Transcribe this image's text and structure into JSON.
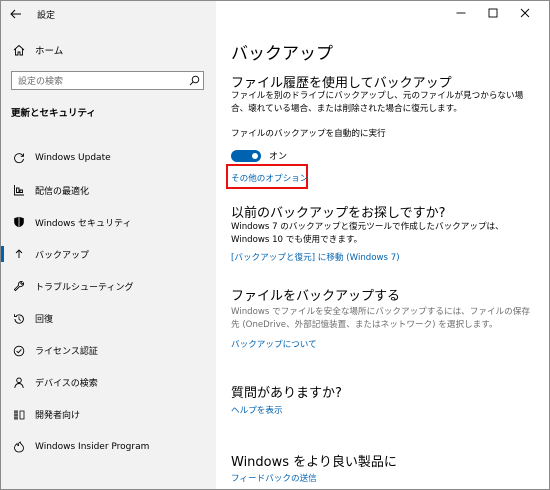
{
  "window": {
    "title": "設定",
    "controls": [
      "minimize",
      "maximize",
      "close"
    ]
  },
  "sidebar": {
    "home_label": "ホーム",
    "search_placeholder": "設定の検索",
    "section_title": "更新とセキュリティ",
    "items": [
      {
        "label": "Windows Update",
        "icon": "refresh-icon"
      },
      {
        "label": "配信の最適化",
        "icon": "delivery-optimization-icon"
      },
      {
        "label": "Windows セキュリティ",
        "icon": "shield-icon"
      },
      {
        "label": "バックアップ",
        "icon": "backup-icon",
        "active": true
      },
      {
        "label": "トラブルシューティング",
        "icon": "wrench-icon"
      },
      {
        "label": "回復",
        "icon": "recovery-icon"
      },
      {
        "label": "ライセンス認証",
        "icon": "checkmark-circle-icon"
      },
      {
        "label": "デバイスの検索",
        "icon": "person-pin-icon"
      },
      {
        "label": "開発者向け",
        "icon": "developer-icon"
      },
      {
        "label": "Windows Insider Program",
        "icon": "insider-icon"
      }
    ]
  },
  "main": {
    "page_title": "バックアップ",
    "file_history": {
      "heading": "ファイル履歴を使用してバックアップ",
      "description": "ファイルを別のドライブにバックアップし、元のファイルが見つからない場合、壊れている場合、または削除された場合に復元します。",
      "auto_backup_label": "ファイルのバックアップを自動的に実行",
      "toggle_state": "オン",
      "toggle_on": true,
      "more_options_link": "その他のオプション"
    },
    "older_backup": {
      "heading": "以前のバックアップをお探しですか?",
      "description": "Windows 7 のバックアップと復元ツールで作成したバックアップは、Windows 10 でも使用できます。",
      "link": "[バックアップと復元] に移動 (Windows 7)"
    },
    "backup_files": {
      "heading": "ファイルをバックアップする",
      "description": "Windows でファイルを安全な場所にバックアップするには、ファイルの保存先 (OneDrive、外部記憶装置、またはネットワーク) を選択します。",
      "link": "バックアップについて"
    },
    "questions": {
      "heading": "質問がありますか?",
      "link": "ヘルプを表示"
    },
    "improve": {
      "heading": "Windows をより良い製品に",
      "link": "フィードバックの送信"
    }
  },
  "colors": {
    "accent": "#0063b1",
    "highlight_box": "#e8110f",
    "sidebar_bg": "#f2f2f2"
  }
}
